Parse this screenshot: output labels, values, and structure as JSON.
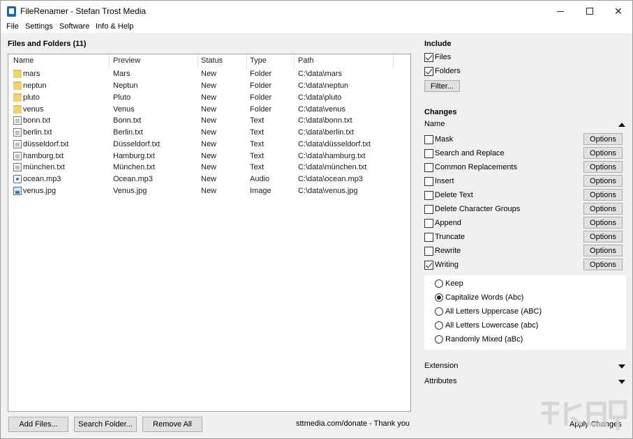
{
  "window": {
    "title": "FileRenamer - Stefan Trost Media",
    "icons": {
      "app": "app-icon",
      "minimize": "minimize-icon",
      "maximize": "maximize-icon",
      "close": "close-icon"
    }
  },
  "menu": [
    "File",
    "Settings",
    "Software",
    "Info & Help"
  ],
  "files_panel": {
    "title": "Files and Folders (11)",
    "columns": [
      "Name",
      "Preview",
      "Status",
      "Type",
      "Path"
    ],
    "rows": [
      {
        "icon": "folder-icon",
        "name": "mars",
        "preview": "Mars",
        "status": "New",
        "type": "Folder",
        "path": "C:\\data\\mars"
      },
      {
        "icon": "folder-icon",
        "name": "neptun",
        "preview": "Neptun",
        "status": "New",
        "type": "Folder",
        "path": "C:\\data\\neptun"
      },
      {
        "icon": "folder-icon",
        "name": "pluto",
        "preview": "Pluto",
        "status": "New",
        "type": "Folder",
        "path": "C:\\data\\pluto"
      },
      {
        "icon": "folder-icon",
        "name": "venus",
        "preview": "Venus",
        "status": "New",
        "type": "Folder",
        "path": "C:\\data\\venus"
      },
      {
        "icon": "text-file-icon",
        "name": "bonn.txt",
        "preview": "Bonn.txt",
        "status": "New",
        "type": "Text",
        "path": "C:\\data\\bonn.txt"
      },
      {
        "icon": "text-file-icon",
        "name": "berlin.txt",
        "preview": "Berlin.txt",
        "status": "New",
        "type": "Text",
        "path": "C:\\data\\berlin.txt"
      },
      {
        "icon": "text-file-icon",
        "name": "düsseldorf.txt",
        "preview": "Düsseldorf.txt",
        "status": "New",
        "type": "Text",
        "path": "C:\\data\\düsseldorf.txt"
      },
      {
        "icon": "text-file-icon",
        "name": "hamburg.txt",
        "preview": "Hamburg.txt",
        "status": "New",
        "type": "Text",
        "path": "C:\\data\\hamburg.txt"
      },
      {
        "icon": "text-file-icon",
        "name": "münchen.txt",
        "preview": "München.txt",
        "status": "New",
        "type": "Text",
        "path": "C:\\data\\münchen.txt"
      },
      {
        "icon": "audio-file-icon",
        "name": "ocean.mp3",
        "preview": "Ocean.mp3",
        "status": "New",
        "type": "Audio",
        "path": "C:\\data\\ocean.mp3"
      },
      {
        "icon": "image-file-icon",
        "name": "venus.jpg",
        "preview": "Venus.jpg",
        "status": "New",
        "type": "Image",
        "path": "C:\\data\\venus.jpg"
      }
    ]
  },
  "bottom_bar": {
    "add_files": "Add Files...",
    "search_folder": "Search Folder...",
    "remove_all": "Remove All",
    "donate_text": "sttmedia.com/donate - Thank you",
    "apply": "Apply Changes"
  },
  "include": {
    "title": "Include",
    "files_label": "Files",
    "files_checked": true,
    "folders_label": "Folders",
    "folders_checked": true,
    "filter_button": "Filter..."
  },
  "changes": {
    "title": "Changes",
    "name_section": "Name",
    "options_label": "Options",
    "items": [
      {
        "label": "Mask",
        "checked": false
      },
      {
        "label": "Search and Replace",
        "checked": false
      },
      {
        "label": "Common Replacements",
        "checked": false
      },
      {
        "label": "Insert",
        "checked": false
      },
      {
        "label": "Delete Text",
        "checked": false
      },
      {
        "label": "Delete Character Groups",
        "checked": false
      },
      {
        "label": "Append",
        "checked": false
      },
      {
        "label": "Truncate",
        "checked": false
      },
      {
        "label": "Rewrite",
        "checked": false
      },
      {
        "label": "Writing",
        "checked": true
      }
    ],
    "writing_options": [
      {
        "label": "Keep",
        "selected": false
      },
      {
        "label": "Capitalize Words (Abc)",
        "selected": true
      },
      {
        "label": "All Letters Uppercase (ABC)",
        "selected": false
      },
      {
        "label": "All Letters Lowercase (abc)",
        "selected": false
      },
      {
        "label": "Randomly Mixed (aBc)",
        "selected": false
      }
    ],
    "extension_section": "Extension",
    "attributes_section": "Attributes"
  }
}
